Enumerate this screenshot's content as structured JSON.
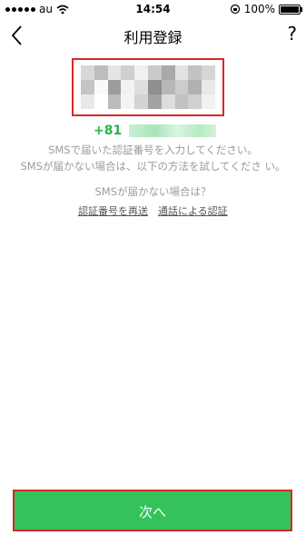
{
  "statusbar": {
    "carrier": "au",
    "time": "14:54",
    "battery_percent": "100%"
  },
  "navbar": {
    "title": "利用登録",
    "help_label": "?"
  },
  "phone": {
    "country_prefix": "+81"
  },
  "messages": {
    "line1": "SMSで届いた認証番号を入力してください。",
    "line2": "SMSが届かない場合は、以下の方法を試してくださ い。",
    "line3": "SMSが届かない場合は？"
  },
  "links": {
    "resend": "認証番号を再送",
    "call": "通話による認証"
  },
  "footer": {
    "next_label": "次へ"
  },
  "colors": {
    "accent_green": "#35c25b",
    "highlight_red": "#d9262a",
    "text_gray": "#9a9a9a"
  }
}
